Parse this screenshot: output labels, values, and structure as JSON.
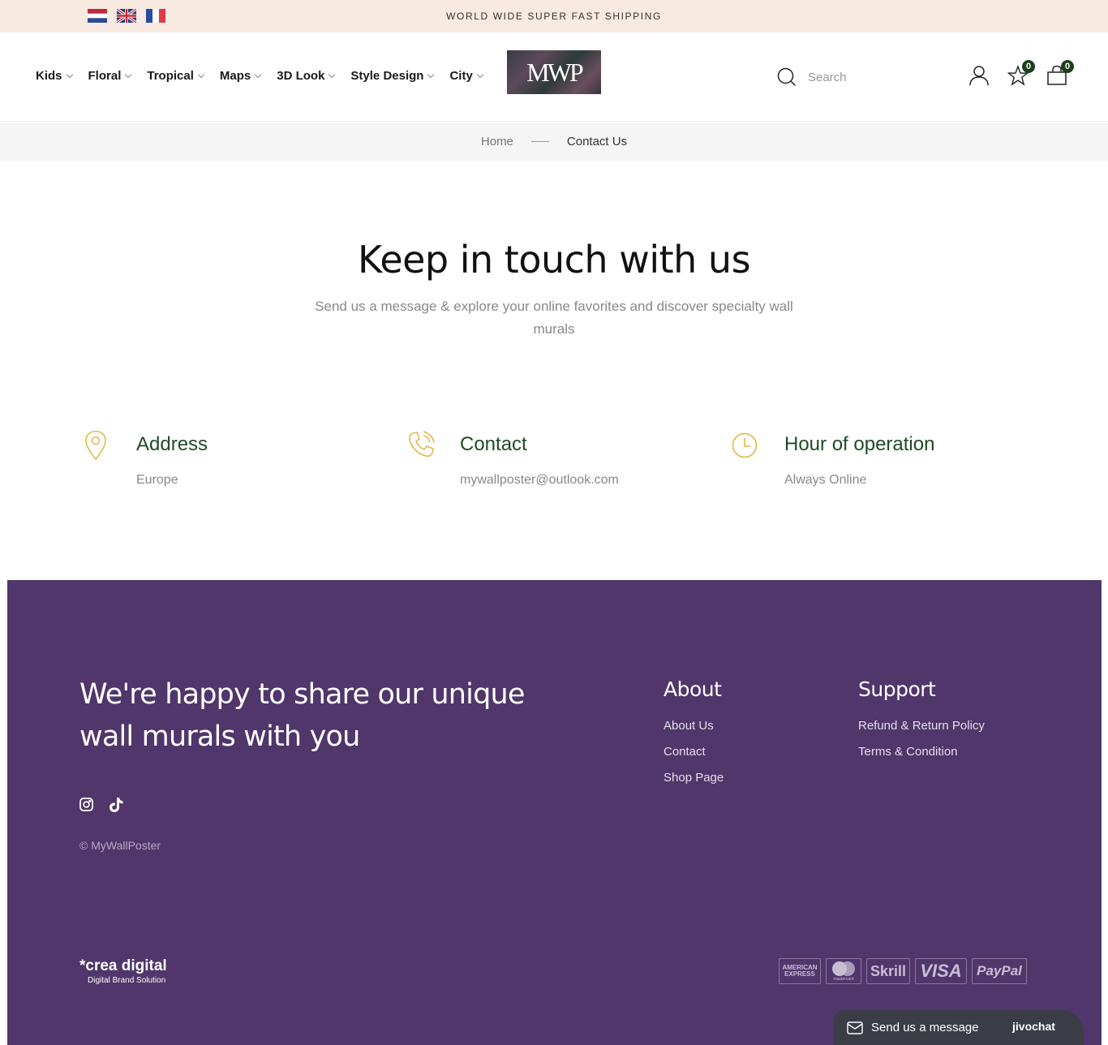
{
  "topbar": {
    "shipping": "WORLD WIDE SUPER FAST SHIPPING",
    "flags": [
      "netherlands-flag",
      "uk-flag",
      "france-flag"
    ]
  },
  "nav": {
    "items": [
      {
        "label": "Kids"
      },
      {
        "label": "Floral"
      },
      {
        "label": "Tropical"
      },
      {
        "label": "Maps"
      },
      {
        "label": "3D Look"
      },
      {
        "label": "Style Design"
      },
      {
        "label": "City"
      }
    ]
  },
  "logo": {
    "text": "MWP"
  },
  "search": {
    "placeholder": "Search"
  },
  "header_icons": {
    "wishlist_count": "0",
    "cart_count": "0"
  },
  "breadcrumb": {
    "home": "Home",
    "current": "Contact Us"
  },
  "hero": {
    "title": "Keep in touch with us",
    "subtitle": "Send us a message & explore your online favorites and discover specialty wall murals"
  },
  "info": [
    {
      "icon": "location-pin-icon",
      "title": "Address",
      "value": "Europe"
    },
    {
      "icon": "phone-icon",
      "title": "Contact",
      "value": "mywallposter@outlook.com"
    },
    {
      "icon": "clock-icon",
      "title": "Hour of operation",
      "value": "Always Online"
    }
  ],
  "footer": {
    "tagline": "We're happy to share our unique wall murals with you",
    "copyright": "© MyWallPoster",
    "about": {
      "title": "About",
      "links": [
        "About Us",
        "Contact",
        "Shop Page"
      ]
    },
    "support": {
      "title": "Support",
      "links": [
        "Refund & Return Policy",
        "Terms & Condition"
      ]
    },
    "credit": {
      "name": "*crea digital",
      "tagline": "Digital Brand Solution"
    },
    "payments": [
      "AMERICAN EXPRESS",
      "mastercard",
      "Skrill",
      "VISA",
      "PayPal"
    ]
  },
  "chat": {
    "label": "Send us a message",
    "brand": "jivochat"
  },
  "colors": {
    "topbar_bg": "#f8e9e1",
    "footer_bg": "#50366a",
    "accent_green": "#1f4a24",
    "icon_gold": "#e2b84a"
  }
}
